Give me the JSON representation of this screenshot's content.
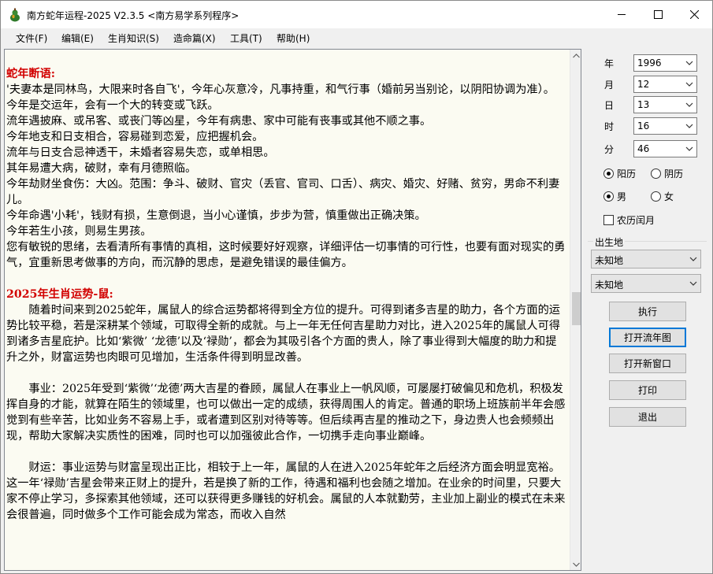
{
  "window": {
    "title": "南方蛇年运程-2025 V2.3.5  <南方易学系列程序>"
  },
  "menu": {
    "items": [
      "文件(F)",
      "编辑(E)",
      "生肖知识(S)",
      "造命篇(X)",
      "工具(T)",
      "帮助(H)"
    ]
  },
  "content": {
    "heading1": "蛇年断语:",
    "lines1": [
      "'夫妻本是同林鸟，大限来时各自飞'，今年心灰意冷，凡事持重，和气行事（婚前另当别论，以阴阳协调为准）。",
      "今年是交运年，会有一个大的转变或飞跃。",
      "流年遇披麻、或吊客、或丧门等凶星，今年有病患、家中可能有丧事或其他不顺之事。",
      "今年地支和日支相合，容易碰到恋爱，应把握机会。",
      "流年与日支合忌神透干，未婚者容易失恋，或单相思。",
      "其年易遭大病，破财，幸有月德照临。",
      "今年劫财坐食伤：大凶。范围：争斗、破财、官灾（丢官、官司、口舌）、病灾、婚灾、好赌、贫穷，男命不利妻儿。",
      "今年命遇'小耗'，钱财有损，生意倒退，当小心谨慎，步步为营，慎重做出正确决策。",
      "今年若生小孩，则易生男孩。",
      "您有敏锐的思绪，去看清所有事情的真相，这时候要好好观察，详细评估一切事情的可行性，也要有面对现实的勇气，宜重新思考做事的方向，而沉静的思虑，是避免错误的最佳偏方。"
    ],
    "heading2": "2025年生肖运势-鼠:",
    "para_general": "随着时间来到2025蛇年，属鼠人的综合运势都将得到全方位的提升。可得到诸多吉星的助力，各个方面的运势比较平稳，若是深耕某个领域，可取得全新的成就。与上一年无任何吉星助力对比，进入2025年的属鼠人可得到诸多吉星庇护。比如‘紫微’ ‘龙德’以及‘禄勋’，都会为其吸引各个方面的贵人，除了事业得到大幅度的助力和提升之外，财富运势也肉眼可见增加，生活条件得到明显改善。",
    "para_career": "事业：2025年受到‘紫微’‘龙德’两大吉星的眷顾，属鼠人在事业上一帆风顺，可屡屡打破偏见和危机，积极发挥自身的才能，就算在陌生的领域里，也可以做出一定的成绩，获得周围人的肯定。普通的职场上班族前半年会感觉到有些辛苦，比如业务不容易上手，或者遭到区别对待等等。但后续再吉星的推动之下，身边贵人也会频频出现，帮助大家解决实质性的困难，同时也可以加强彼此合作，一切携手走向事业巅峰。",
    "para_wealth": "财运：事业运势与财富呈现出正比，相较于上一年，属鼠的人在进入2025年蛇年之后经济方面会明显宽裕。这一年‘禄勋’吉星会带来正财上的提升，若是换了新的工作，待遇和福利也会随之增加。在业余的时间里，只要大家不停止学习，多探索其他领域，还可以获得更多赚钱的好机会。属鼠的人本就勤劳，主业加上副业的模式在未来会很普遍，同时做多个工作可能会成为常态，而收入自然"
  },
  "panel": {
    "year_label": "年",
    "year_value": "1996",
    "month_label": "月",
    "month_value": "12",
    "day_label": "日",
    "day_value": "13",
    "hour_label": "时",
    "hour_value": "16",
    "minute_label": "分",
    "minute_value": "46",
    "solar_label": "阳历",
    "lunar_label": "阴历",
    "male_label": "男",
    "female_label": "女",
    "leap_label": "农历闰月",
    "birthplace_label": "出生地",
    "province_value": "未知地",
    "city_value": "未知地",
    "calendar_selected": "solar",
    "gender_selected": "male",
    "leap_checked": false
  },
  "buttons": {
    "execute": "执行",
    "open_year_chart": "打开流年图",
    "open_new_window": "打开新窗口",
    "print": "打印",
    "exit": "退出"
  },
  "icons": {
    "app": "gourd-icon",
    "minimize": "minimize-icon",
    "maximize": "maximize-icon",
    "close": "close-icon",
    "dropdown": "chevron-down-icon"
  },
  "colors": {
    "heading": "#d20000",
    "content_bg": "#fbfbf2",
    "focus_border": "#0078d7"
  }
}
